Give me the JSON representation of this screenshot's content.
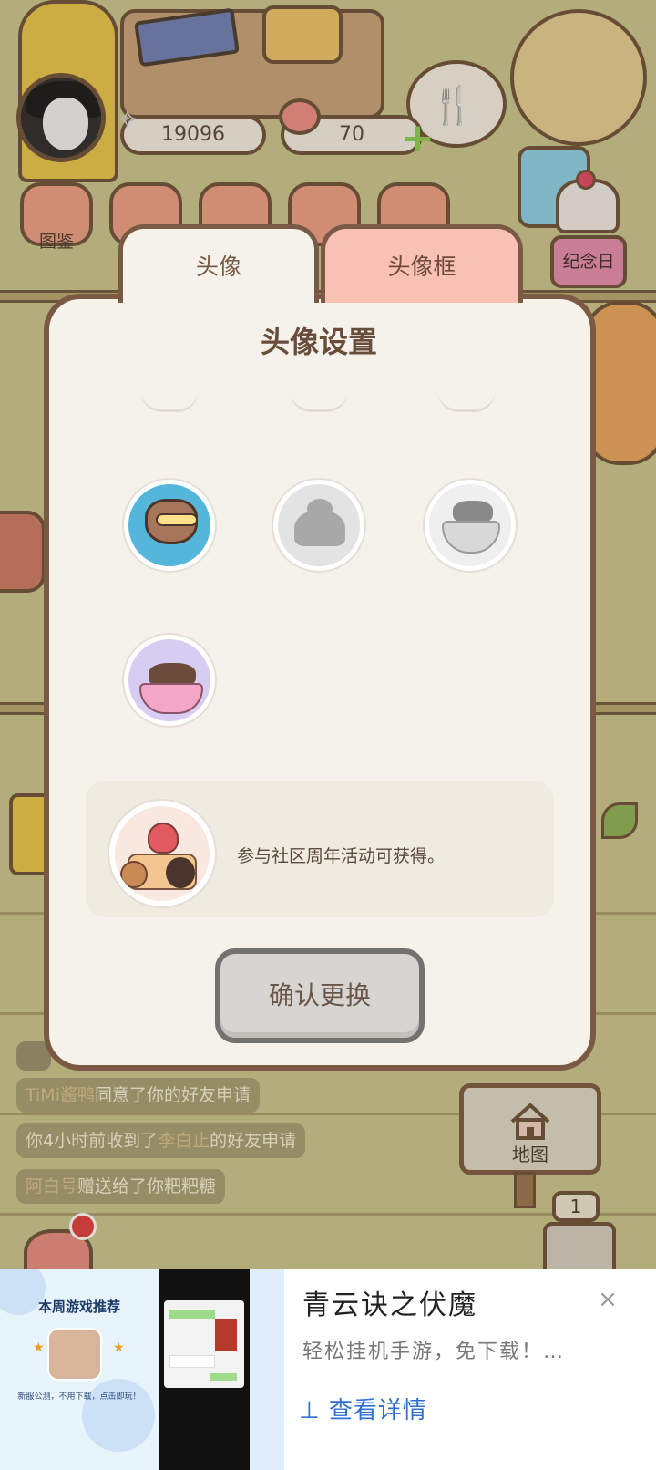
{
  "hud": {
    "fish_count": "19096",
    "heart_count": "70",
    "atlas_label": "图鉴",
    "anniversary_label": "纪念日",
    "map_label": "地图",
    "machine_count": "1"
  },
  "notifications": [
    {
      "name": "TiMi酱鸭",
      "text": "同意了你的好友申请"
    },
    {
      "prefix": "你4小时前收到了",
      "name": "李白止",
      "text": "的好友申请"
    },
    {
      "name": "阿白号",
      "text": "赠送给了你粑粑糖"
    }
  ],
  "dialog": {
    "tabs": [
      {
        "label": "头像",
        "active": true
      },
      {
        "label": "头像框",
        "active": false
      }
    ],
    "title": "头像设置",
    "avatar_options": [
      {
        "icon": "raccoon-snorkel-avatar",
        "locked": false
      },
      {
        "icon": "poop-avatar",
        "locked": true
      },
      {
        "icon": "teacup-cats-avatar",
        "locked": true
      },
      {
        "icon": "party-teacup-avatar",
        "locked": false
      }
    ],
    "selected_description": "参与社区周年活动可获得。",
    "confirm_label": "确认更换"
  },
  "ad": {
    "left_title": "本周游戏推荐",
    "left_subtitle": "新服公测，不用下载，点击即玩！",
    "title": "青云诀之伏魔",
    "description": "轻松挂机手游，免下载！…",
    "cta": "⊥ 查看详情",
    "close": "×"
  },
  "colors": {
    "dialog_bg": "#f5f2ec",
    "dialog_border": "#7a5a45",
    "inactive_tab": "#f8c1b1",
    "button_bg": "#d7d5d2",
    "ad_link": "#2e6fd0"
  }
}
